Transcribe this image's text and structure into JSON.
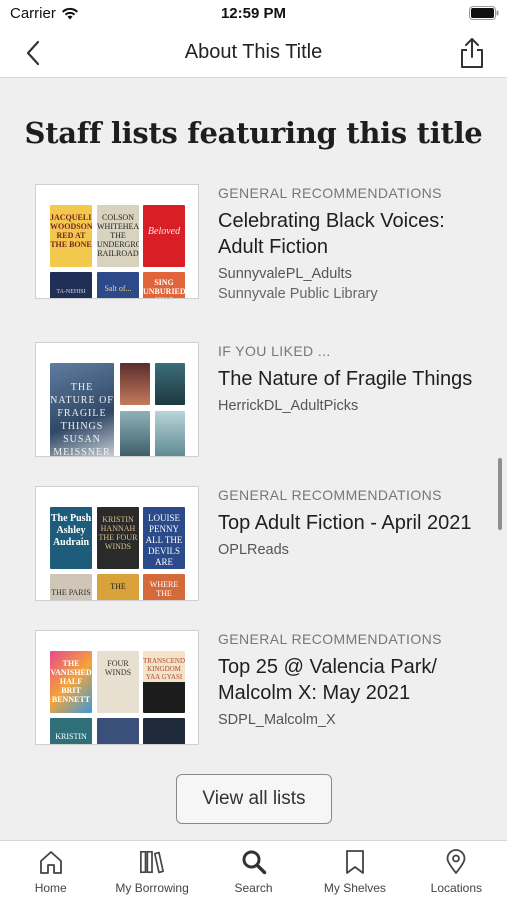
{
  "status_bar": {
    "carrier": "Carrier",
    "time": "12:59 PM"
  },
  "nav": {
    "title": "About This Title",
    "back_icon": "chevron-left-icon",
    "share_icon": "share-icon"
  },
  "section": {
    "heading": "Staff lists featuring this title"
  },
  "lists": [
    {
      "category": "GENERAL RECOMMENDATIONS",
      "title": "Celebrating Black Voices: Adult Fiction",
      "owner": "SunnyvalePL_Adults",
      "library": "Sunnyvale Public Library",
      "covers": [
        {
          "text": "JACQUELINE WOODSON RED AT THE BONE"
        },
        {
          "text": "COLSON WHITEHEAD THE UNDERGROUND RAILROAD"
        },
        {
          "text": "Beloved"
        },
        {
          "text": "TA-NEHISI COATES"
        },
        {
          "text": "Salt of..."
        },
        {
          "text": "SING UNBURIED SING"
        }
      ]
    },
    {
      "category": "IF YOU LIKED ...",
      "title": "The Nature of Fragile Things",
      "owner": "HerrickDL_AdultPicks",
      "library": "",
      "covers": [
        {
          "text": "THE NATURE OF FRAGILE THINGS SUSAN MEISSNER"
        },
        {
          "text": ""
        },
        {
          "text": ""
        },
        {
          "text": ""
        },
        {
          "text": ""
        }
      ]
    },
    {
      "category": "GENERAL RECOMMENDATIONS",
      "title": "Top Adult Fiction - April 2021",
      "owner": "OPLReads",
      "library": "",
      "covers": [
        {
          "text": "The Push Ashley Audrain"
        },
        {
          "text": "KRISTIN HANNAH THE FOUR WINDS"
        },
        {
          "text": "LOUISE PENNY ALL THE DEVILS ARE HERE"
        },
        {
          "text": "THE PARIS"
        },
        {
          "text": "THE"
        },
        {
          "text": "WHERE THE"
        }
      ]
    },
    {
      "category": "GENERAL RECOMMENDATIONS",
      "title": "Top 25 @ Valencia Park/ Malcolm X: May 2021",
      "owner": "SDPL_Malcolm_X",
      "library": "",
      "covers": [
        {
          "text": "THE VANISHED HALF BRIT BENNETT"
        },
        {
          "text": "FOUR WINDS"
        },
        {
          "text": "TRANSCENDENT KINGDOM YAA GYASI"
        },
        {
          "text": "KRISTIN"
        },
        {
          "text": ""
        },
        {
          "text": ""
        }
      ]
    }
  ],
  "view_all_label": "View all lists",
  "tabs": [
    {
      "label": "Home",
      "icon": "home-icon"
    },
    {
      "label": "My Borrowing",
      "icon": "books-icon"
    },
    {
      "label": "Search",
      "icon": "search-icon"
    },
    {
      "label": "My Shelves",
      "icon": "bookmark-icon"
    },
    {
      "label": "Locations",
      "icon": "location-pin-icon"
    }
  ],
  "colors": {
    "content_bg": "#efefef",
    "text": "#222222",
    "muted": "#777777"
  }
}
